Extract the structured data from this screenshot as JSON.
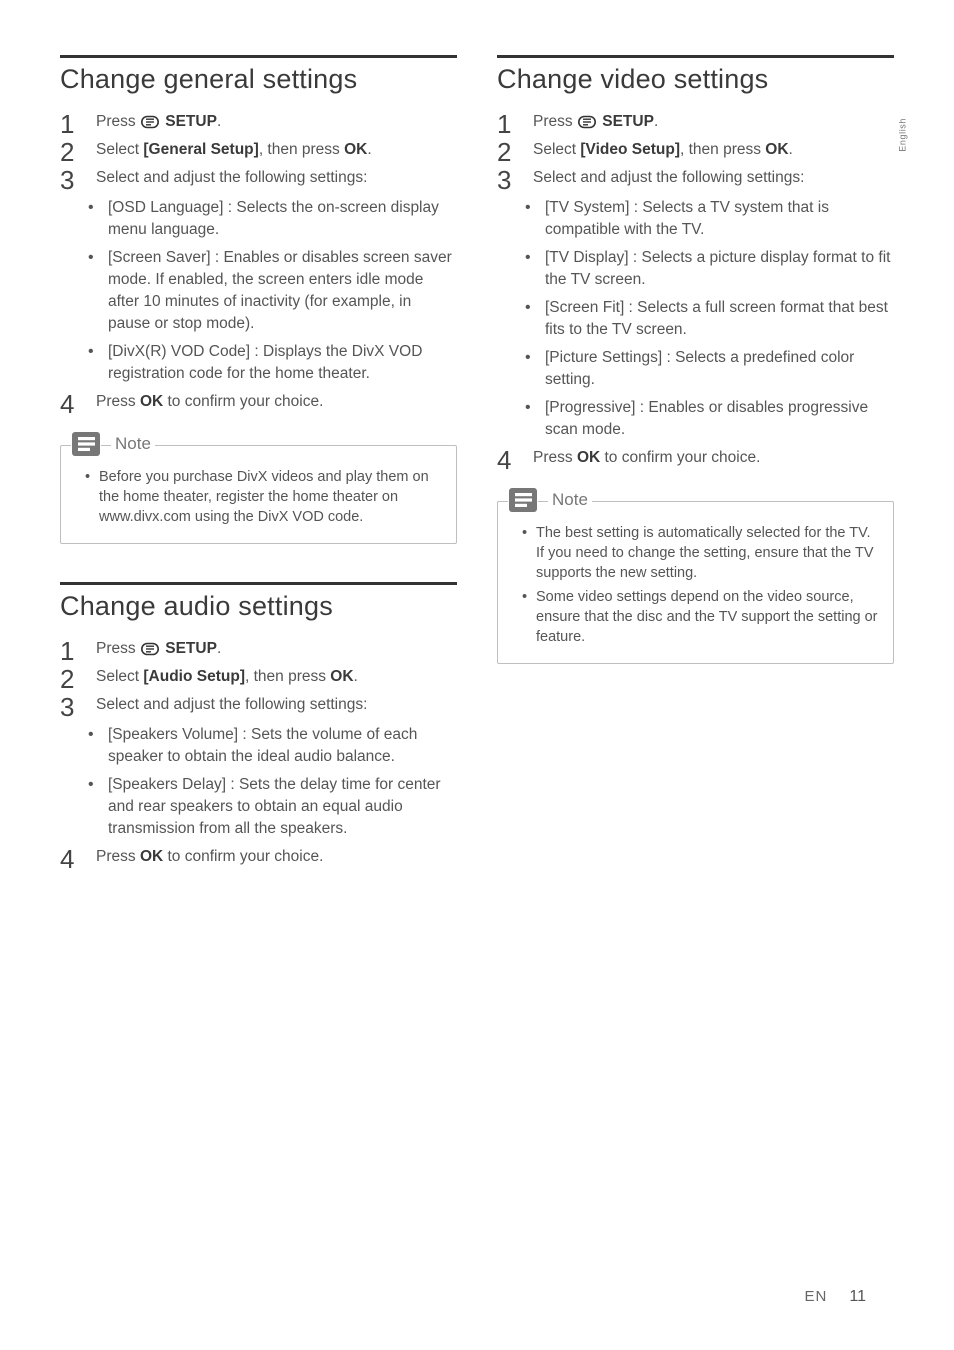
{
  "lang_tab": "English",
  "footer": {
    "lang": "EN",
    "page": "11"
  },
  "note_label": "Note",
  "setup_word": "SETUP",
  "sections": {
    "general": {
      "title": "Change general settings",
      "step1_a": "Press ",
      "step1_b": ".",
      "step2_a": "Select ",
      "step2_b": "[General Setup]",
      "step2_c": ", then press ",
      "step2_d": "OK",
      "step2_e": ".",
      "step3": "Select and adjust the following settings:",
      "bullets": [
        {
          "b": "[OSD Language]",
          "t": " : Selects the on-screen display menu language."
        },
        {
          "b": "[Screen Saver]",
          "t": " : Enables or disables screen saver mode. If enabled, the screen enters idle mode after 10 minutes of inactivity (for example, in pause or stop mode)."
        },
        {
          "b": "[DivX(R) VOD Code]",
          "t": " : Displays the DivX VOD registration code for the home theater."
        }
      ],
      "step4_a": "Press ",
      "step4_b": "OK",
      "step4_c": " to confirm your choice.",
      "note": [
        "Before you purchase DivX videos and play them on the home theater, register the home theater on www.divx.com using the DivX VOD code."
      ]
    },
    "audio": {
      "title": "Change audio settings",
      "step1_a": "Press ",
      "step1_b": ".",
      "step2_a": "Select ",
      "step2_b": "[Audio Setup]",
      "step2_c": ", then press ",
      "step2_d": "OK",
      "step2_e": ".",
      "step3": "Select and adjust the following settings:",
      "bullets": [
        {
          "b": "[Speakers Volume]",
          "t": " : Sets the volume of each speaker to obtain the ideal audio balance."
        },
        {
          "b": "[Speakers Delay]",
          "t": " : Sets the delay time for center and rear speakers to obtain an equal audio transmission from all the speakers."
        }
      ],
      "step4_a": "Press ",
      "step4_b": "OK",
      "step4_c": " to confirm your choice."
    },
    "video": {
      "title": "Change video settings",
      "step1_a": "Press ",
      "step1_b": ".",
      "step2_a": "Select ",
      "step2_b": "[Video Setup]",
      "step2_c": ", then press ",
      "step2_d": "OK",
      "step2_e": ".",
      "step3": "Select and adjust the following settings:",
      "bullets": [
        {
          "b": "[TV System]",
          "t": " : Selects a TV system that is compatible with the TV."
        },
        {
          "b": "[TV Display]",
          "t": " : Selects a picture display format to fit the TV screen."
        },
        {
          "b": "[Screen Fit]",
          "t": " : Selects a full screen format that best fits to the TV screen."
        },
        {
          "b": "[Picture Settings]",
          "t": " : Selects a predefined color setting."
        },
        {
          "b": "[Progressive]",
          "t": " : Enables or disables progressive scan mode."
        }
      ],
      "step4_a": "Press ",
      "step4_b": "OK",
      "step4_c": " to confirm your choice.",
      "note": [
        "The best setting is automatically selected for the TV. If you need to change the setting, ensure that the TV supports the new setting.",
        "Some video settings depend on the video source, ensure that the disc and the TV support the setting or feature."
      ]
    }
  }
}
